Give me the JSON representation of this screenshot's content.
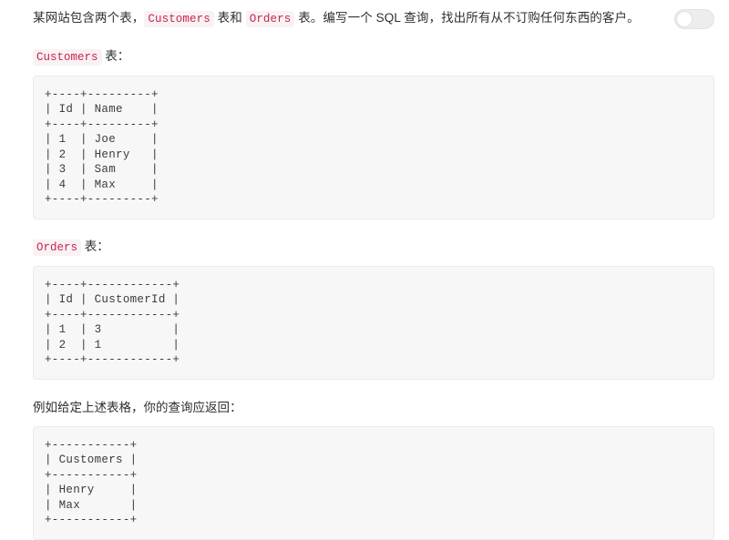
{
  "header": {
    "intro_parts": [
      {
        "type": "text",
        "value": "某网站包含两个表，"
      },
      {
        "type": "code",
        "value": "Customers"
      },
      {
        "type": "text",
        "value": " 表和 "
      },
      {
        "type": "code",
        "value": "Orders"
      },
      {
        "type": "text",
        "value": " 表。编写一个 SQL 查询，找出所有从不订购任何东西的客户。"
      }
    ],
    "toggle": {
      "name": "theme-toggle",
      "state": "off",
      "track_color": "#ededed",
      "knob_color": "#ffffff"
    }
  },
  "sections": [
    {
      "label_code": "Customers",
      "label_suffix": " 表：",
      "code": "+----+---------+\n| Id | Name    |\n+----+---------+\n| 1  | Joe     |\n| 2  | Henry   |\n| 3  | Sam     |\n| 4  | Max     |\n+----+---------+"
    },
    {
      "label_code": "Orders",
      "label_suffix": " 表：",
      "code": "+----+------------+\n| Id | CustomerId |\n+----+------------+\n| 1  | 3          |\n| 2  | 1          |\n+----+------------+"
    }
  ],
  "example": {
    "paragraph": "例如给定上述表格，你的查询应返回：",
    "code": "+-----------+\n| Customers |\n+-----------+\n| Henry     |\n| Max       |\n+-----------+"
  },
  "colors": {
    "page_background": "#ffffff",
    "body_text": "#2f2f2f",
    "inline_code_text": "#c7254e",
    "inline_code_background": "#f9f2f4",
    "codeblock_background": "#f7f7f7",
    "codeblock_border": "#eaeaea",
    "codeblock_text": "#3b3b3b"
  }
}
